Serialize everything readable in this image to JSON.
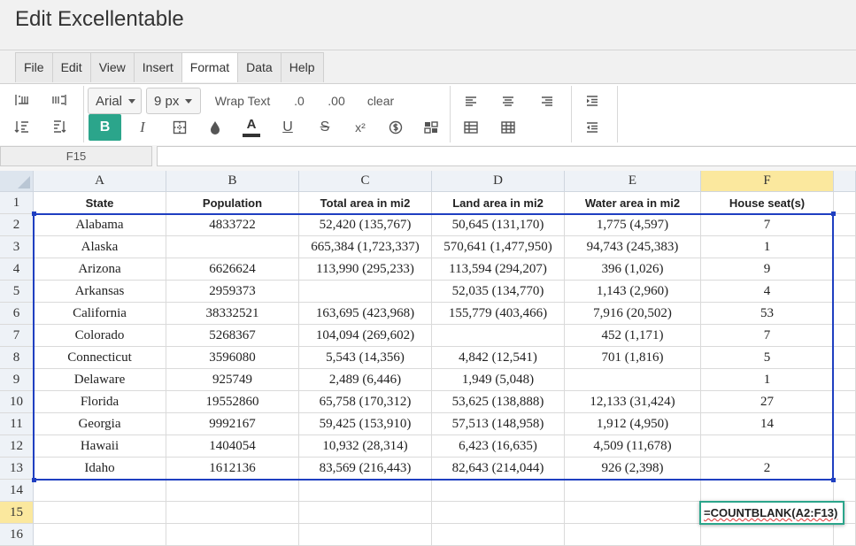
{
  "window": {
    "title": "Edit Excellentable"
  },
  "menu": [
    {
      "label": "File",
      "active": false
    },
    {
      "label": "Edit",
      "active": false
    },
    {
      "label": "View",
      "active": false
    },
    {
      "label": "Insert",
      "active": false
    },
    {
      "label": "Format",
      "active": true
    },
    {
      "label": "Data",
      "active": false
    },
    {
      "label": "Help",
      "active": false
    }
  ],
  "toolbar": {
    "font_family": "Arial",
    "font_size": "9 px",
    "wrap_text": "Wrap Text",
    "decimal_decrease": ".0",
    "decimal_increase": ".00",
    "clear": "clear",
    "bold": "B",
    "italic": "I",
    "underline": "U",
    "strike": "S",
    "superscript": "x²",
    "accent_color": "#2ba58b"
  },
  "formula_bar": {
    "cell_ref": "F15",
    "value": ""
  },
  "grid": {
    "columns": [
      "A",
      "B",
      "C",
      "D",
      "E",
      "F"
    ],
    "selected_column": "F",
    "row_numbers": [
      "1",
      "2",
      "3",
      "4",
      "5",
      "6",
      "7",
      "8",
      "9",
      "10",
      "11",
      "12",
      "13",
      "14",
      "15",
      "16"
    ],
    "selected_row": "15",
    "header": [
      "State",
      "Population",
      "Total area in mi2",
      "Land area in mi2",
      "Water area in mi2",
      "House seat(s)"
    ],
    "rows": [
      [
        "Alabama",
        "4833722",
        "52,420 (135,767)",
        "50,645 (131,170)",
        "1,775 (4,597)",
        "7"
      ],
      [
        "Alaska",
        "",
        "665,384 (1,723,337)",
        "570,641 (1,477,950)",
        "94,743 (245,383)",
        "1"
      ],
      [
        "Arizona",
        "6626624",
        "113,990 (295,233)",
        "113,594 (294,207)",
        "396 (1,026)",
        "9"
      ],
      [
        "Arkansas",
        "2959373",
        "",
        "52,035 (134,770)",
        "1,143 (2,960)",
        "4"
      ],
      [
        "California",
        "38332521",
        "163,695 (423,968)",
        "155,779 (403,466)",
        "7,916 (20,502)",
        "53"
      ],
      [
        "Colorado",
        "5268367",
        "104,094 (269,602)",
        "",
        "452 (1,171)",
        "7"
      ],
      [
        "Connecticut",
        "3596080",
        "5,543 (14,356)",
        "4,842 (12,541)",
        "701 (1,816)",
        "5"
      ],
      [
        "Delaware",
        "925749",
        "2,489 (6,446)",
        "1,949 (5,048)",
        "",
        "1"
      ],
      [
        "Florida",
        "19552860",
        "65,758 (170,312)",
        "53,625 (138,888)",
        "12,133 (31,424)",
        "27"
      ],
      [
        "Georgia",
        "9992167",
        "59,425 (153,910)",
        "57,513 (148,958)",
        "1,912 (4,950)",
        "14"
      ],
      [
        "Hawaii",
        "1404054",
        "10,932 (28,314)",
        "6,423 (16,635)",
        "4,509 (11,678)",
        ""
      ],
      [
        "Idaho",
        "1612136",
        "83,569 (216,443)",
        "82,643 (214,044)",
        "926 (2,398)",
        "2"
      ]
    ],
    "selection_color": "#1f3fc1",
    "editing_cell": {
      "ref": "F15",
      "formula": "=COUNTBLANK(A2:F13)"
    }
  }
}
